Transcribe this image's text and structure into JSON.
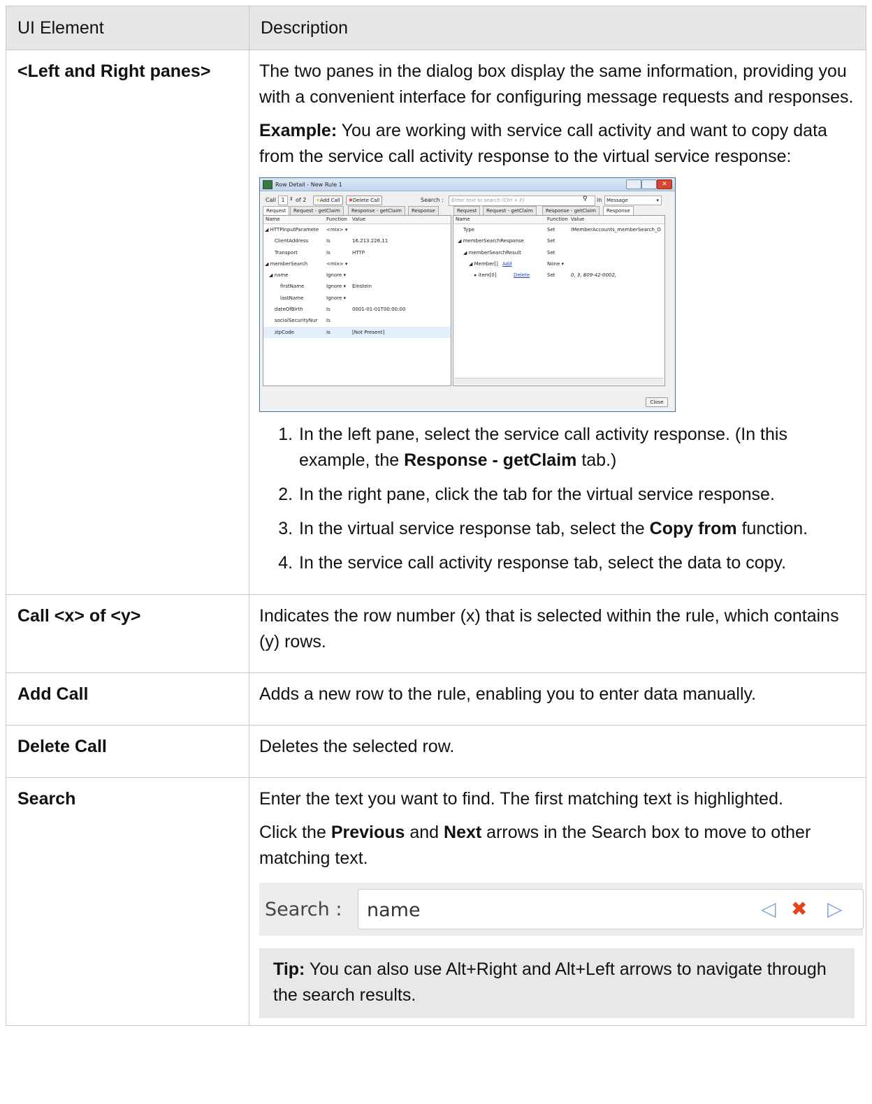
{
  "table": {
    "headers": [
      "UI Element",
      "Description"
    ],
    "row1": {
      "element": "<Left and Right panes>",
      "desc_p1": "The two panes in the dialog box display the same information, providing you with a convenient interface for configuring message requests and responses.",
      "example_label": "Example:",
      "example_text": " You are working with service call activity and want to copy data from the service call activity response to the virtual service response:",
      "steps": [
        {
          "pre": "In the left pane, select the service call activity response. (In this example, the ",
          "bold": "Response - getClaim",
          "post": " tab.)"
        },
        {
          "pre": "In the right pane, click the tab for the virtual service response.",
          "bold": "",
          "post": ""
        },
        {
          "pre": "In the virtual service response tab, select the ",
          "bold": "Copy from",
          "post": " function."
        },
        {
          "pre": "In the service call activity response tab, select the data to copy.",
          "bold": "",
          "post": ""
        }
      ]
    },
    "row2": {
      "element": "Call <x> of <y>",
      "desc": "Indicates the row number (x) that is selected within the rule, which contains (y) rows."
    },
    "row3": {
      "element": "Add Call",
      "desc": "Adds a new row to the rule, enabling you to enter data manually."
    },
    "row4": {
      "element": "Delete Call",
      "desc": "Deletes the selected row."
    },
    "row5": {
      "element": "Search",
      "desc_p1": "Enter the text you want to find. The first matching text is highlighted.",
      "p2_a": "Click the ",
      "p2_b": "Previous",
      "p2_c": " and ",
      "p2_d": "Next",
      "p2_e": " arrows in the Search box to move to other matching text.",
      "search_label": "Search :",
      "search_value": "name",
      "tip_label": "Tip:",
      "tip_text": " You can also use Alt+Right and Alt+Left arrows to navigate through the search results."
    }
  },
  "dialog": {
    "title": "Row Detail - New Rule 1",
    "call_label": "Call",
    "call_value": "1",
    "of_label": "of 2",
    "add_call": "Add Call",
    "delete_call": "Delete Call",
    "search_label": "Search :",
    "search_placeholder": "Enter text to search (Ctrl + F)",
    "in_label": "in",
    "in_value": "Message",
    "left_tabs": [
      "Request",
      "Request - getClaim",
      "Response - getClaim",
      "Response"
    ],
    "right_tabs": [
      "Request",
      "Request - getClaim",
      "Response - getClaim",
      "Response"
    ],
    "col_name": "Name",
    "col_function": "Function",
    "col_value": "Value",
    "left_rows": [
      {
        "name": "◢ HTTPInputParamete",
        "fn": "<mix> ▾",
        "val": ""
      },
      {
        "name": "ClientAddress",
        "fn": "Is",
        "val": "16.213.226.11"
      },
      {
        "name": "Transport",
        "fn": "Is",
        "val": "HTTP"
      },
      {
        "name": "◢ memberSearch",
        "fn": "<mix> ▾",
        "val": ""
      },
      {
        "name": "◢ name",
        "fn": "Ignore ▾",
        "val": ""
      },
      {
        "name": "firstName",
        "fn": "Ignore ▾",
        "val": "Einstein"
      },
      {
        "name": "lastName",
        "fn": "Ignore ▾",
        "val": ""
      },
      {
        "name": "dateOfBirth",
        "fn": "Is",
        "val": "0001-01-01T00:00:00"
      },
      {
        "name": "socialSecurityNur",
        "fn": "Is",
        "val": ""
      },
      {
        "name": "zipCode",
        "fn": "Is",
        "val": "[Not Present]"
      }
    ],
    "right_rows": [
      {
        "name": "Type",
        "fn": "Set",
        "val": "IMemberAccounts_memberSearch_O"
      },
      {
        "name": "◢ memberSearchResponse",
        "fn": "Set",
        "val": ""
      },
      {
        "name": "◢ memberSearchResult",
        "fn": "Set",
        "val": ""
      },
      {
        "name": "◢ Member[]",
        "link": "Add",
        "fn": "None ▾",
        "val": ""
      },
      {
        "name": "▸ item[0]",
        "link": "Delete",
        "fn": "Set",
        "val": "0, 3, 809-42-0002,"
      }
    ],
    "close": "Close"
  }
}
